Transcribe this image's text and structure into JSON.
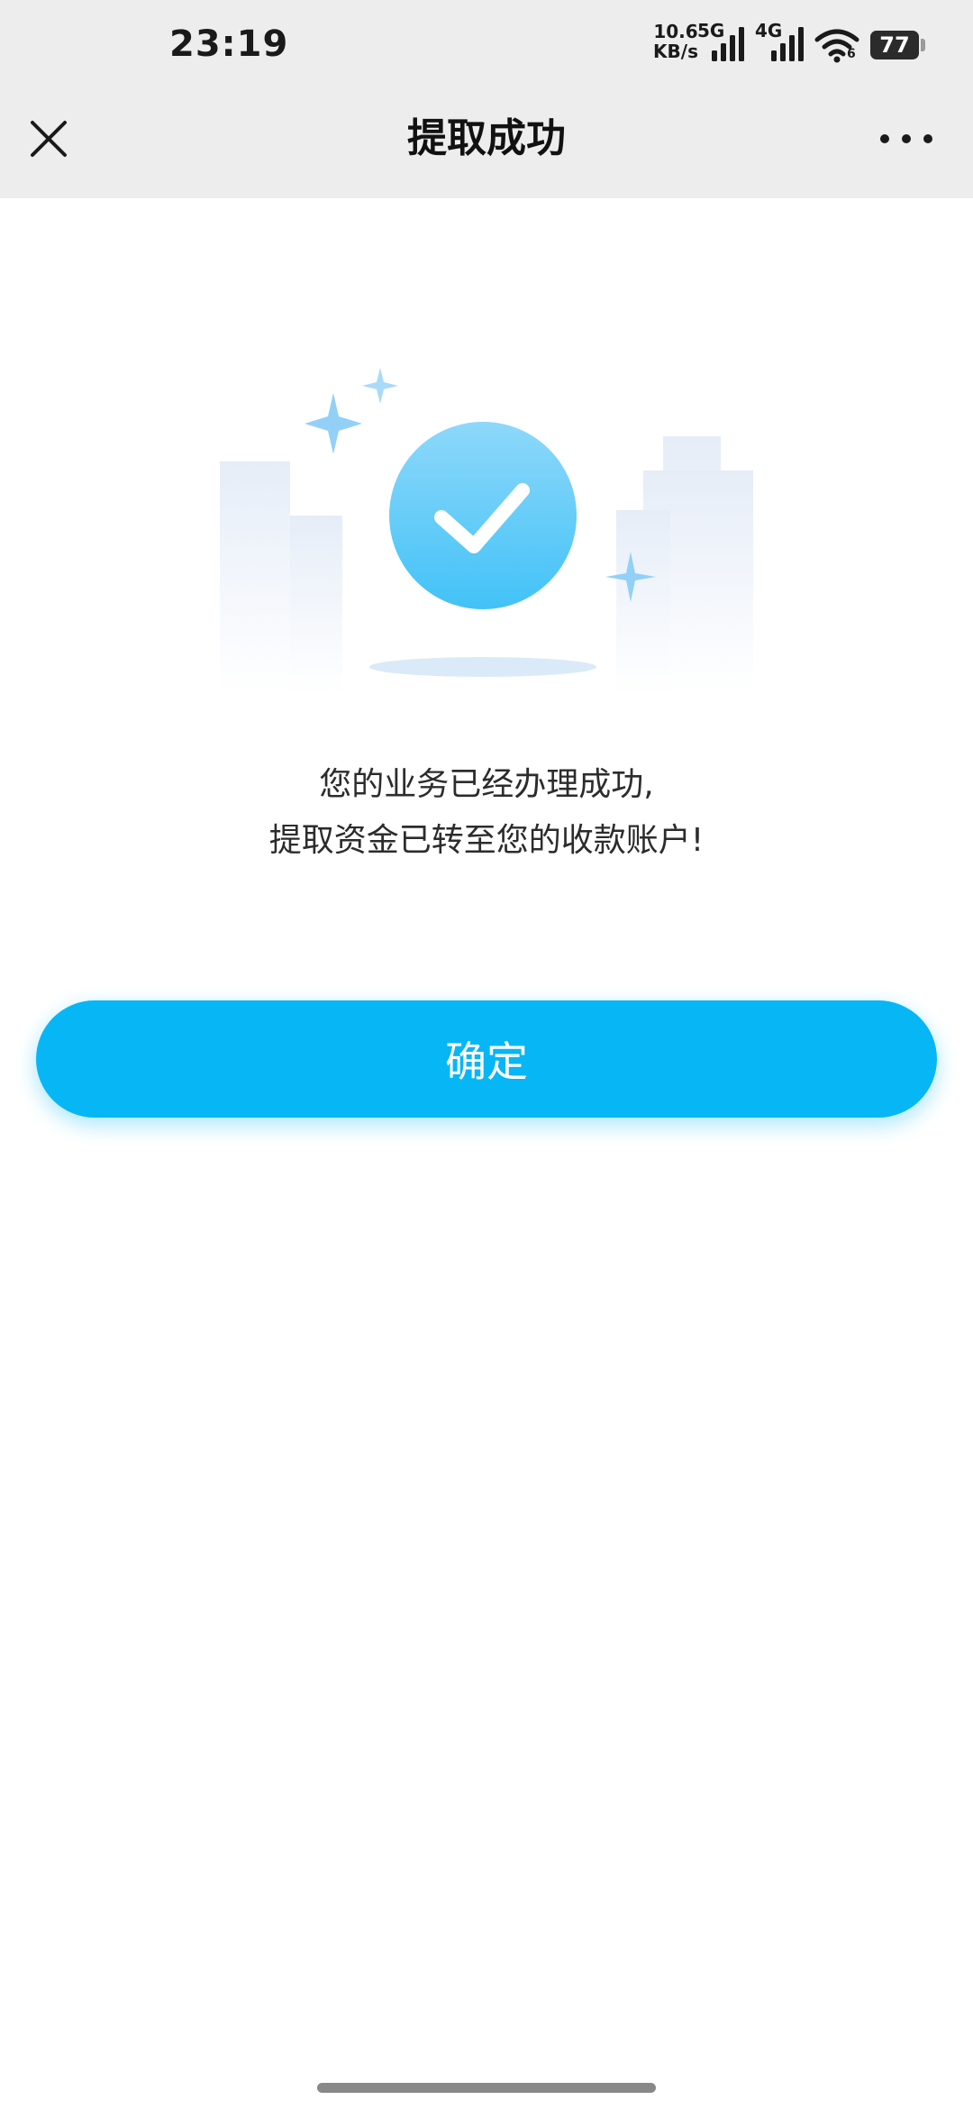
{
  "status_bar": {
    "time": "23:19",
    "network_speed_value": "10.6",
    "network_speed_unit": "KB/s",
    "signal_1_label": "5G",
    "signal_2_label": "4G",
    "wifi_sub_label": "6",
    "battery_level": "77",
    "icons": [
      "signal-5g-icon",
      "signal-4g-icon",
      "wifi-icon",
      "battery-icon"
    ]
  },
  "nav": {
    "title": "提取成功",
    "close_icon": "close-icon",
    "more_icon": "more-dots-icon"
  },
  "illustration": {
    "icon": "success-check-icon",
    "accent_color": "#5ccaf8"
  },
  "message": {
    "line1": "您的业务已经办理成功,",
    "line2": "提取资金已转至您的收款账户!"
  },
  "confirm_button": {
    "label": "确定",
    "color": "#07b6f5"
  }
}
